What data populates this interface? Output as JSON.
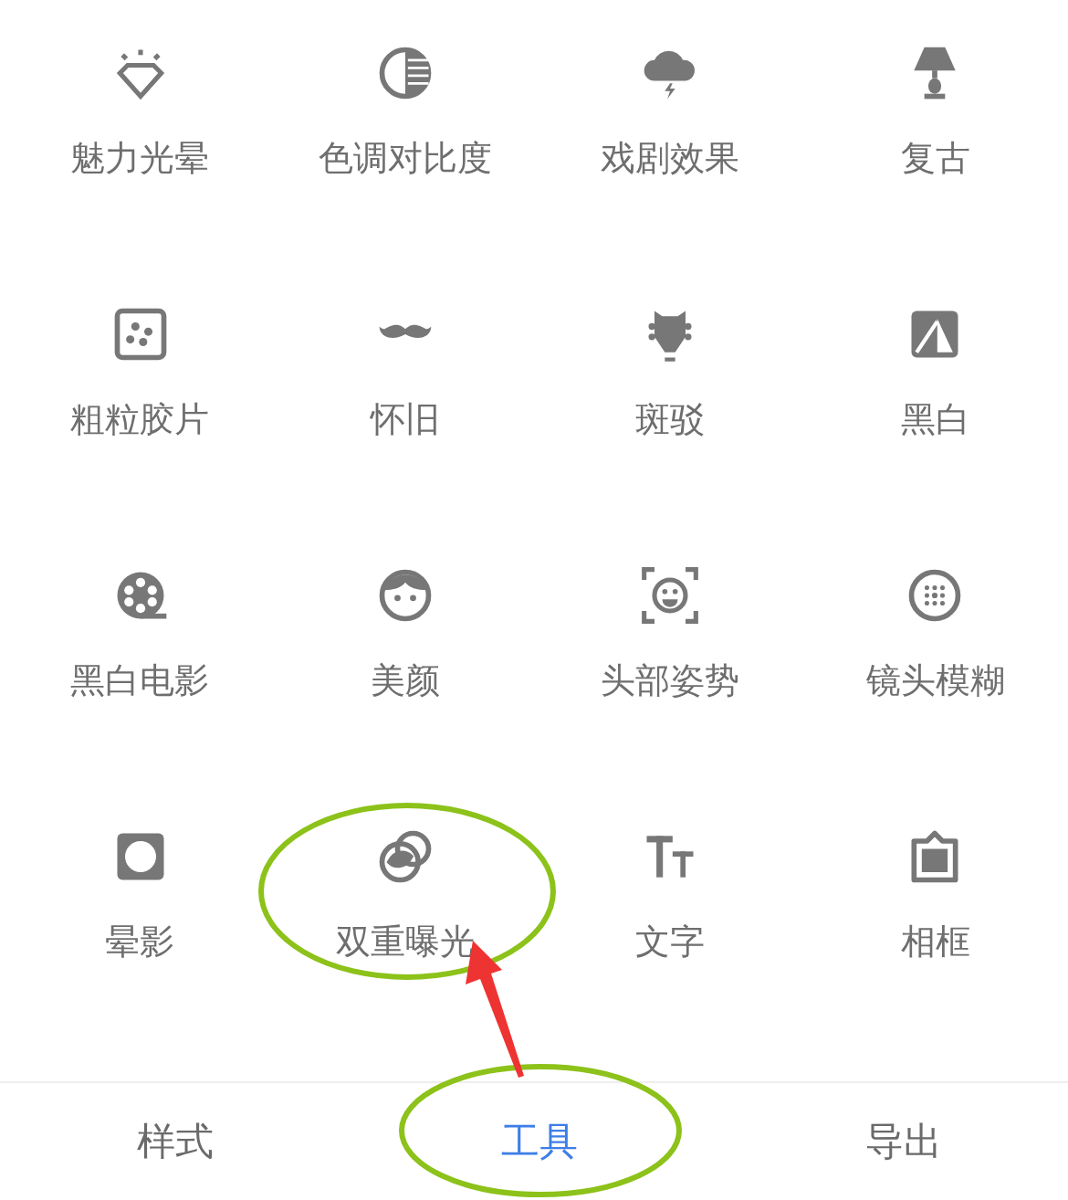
{
  "tools": [
    {
      "label": "魅力光晕"
    },
    {
      "label": "色调对比度"
    },
    {
      "label": "戏剧效果"
    },
    {
      "label": "复古"
    },
    {
      "label": "粗粒胶片"
    },
    {
      "label": "怀旧"
    },
    {
      "label": "斑驳"
    },
    {
      "label": "黑白"
    },
    {
      "label": "黑白电影"
    },
    {
      "label": "美颜"
    },
    {
      "label": "头部姿势"
    },
    {
      "label": "镜头模糊"
    },
    {
      "label": "晕影"
    },
    {
      "label": "双重曝光"
    },
    {
      "label": "文字"
    },
    {
      "label": "相框"
    }
  ],
  "tabs": [
    {
      "label": "样式",
      "selected": false
    },
    {
      "label": "工具",
      "selected": true
    },
    {
      "label": "导出",
      "selected": false
    }
  ]
}
